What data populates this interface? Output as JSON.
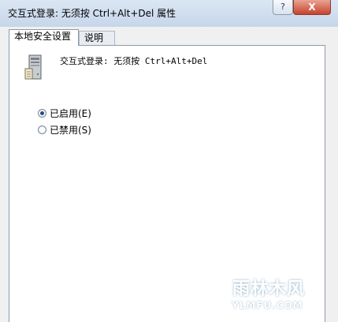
{
  "window": {
    "title": "交互式登录: 无须按 Ctrl+Alt+Del 属性",
    "help_button": "?",
    "close_button": "X"
  },
  "tabs": [
    {
      "label": "本地安全设置",
      "active": true
    },
    {
      "label": "说明",
      "active": false
    }
  ],
  "panel": {
    "policy_title": "交互式登录: 无须按 Ctrl+Alt+Del",
    "icon": "server-computer-icon",
    "options": [
      {
        "label": "已启用(E)",
        "checked": true
      },
      {
        "label": "已禁用(S)",
        "checked": false
      }
    ]
  },
  "watermark": {
    "text": "雨林木风",
    "url": "YLMFU.COM"
  }
}
